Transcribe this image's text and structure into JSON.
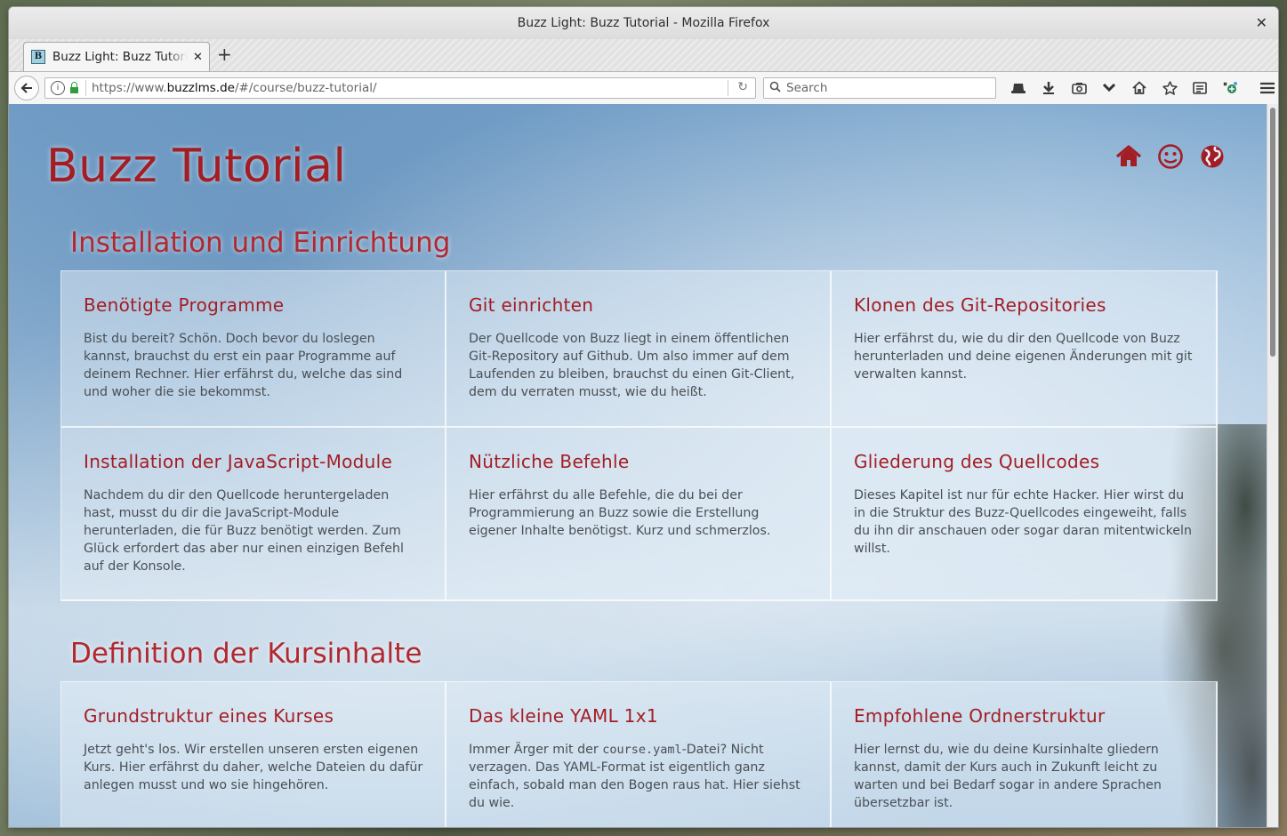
{
  "window": {
    "title": "Buzz Light: Buzz Tutorial - Mozilla Firefox"
  },
  "tab": {
    "favicon_letter": "B",
    "title": "Buzz Light: Buzz Tutorial"
  },
  "nav": {
    "url_prefix": "https://www.",
    "url_domain": "buzzlms.de",
    "url_path": "/#/course/buzz-tutorial/",
    "search_placeholder": "Search"
  },
  "toolbar_icons": [
    "hat-icon",
    "download-icon",
    "screenshot-icon",
    "pocket-icon",
    "home-icon",
    "bookmark-star-icon",
    "reader-icon",
    "extension-icon",
    "menu-icon"
  ],
  "page": {
    "title": "Buzz Tutorial",
    "header_icons": [
      "home-icon",
      "smiley-icon",
      "globe-icon"
    ],
    "accent_color": "#a31d24"
  },
  "sections": [
    {
      "title": "Installation und Einrichtung",
      "cards": [
        {
          "title": "Benötigte Programme",
          "text": "Bist du bereit? Schön. Doch bevor du loslegen kannst, brauchst du erst ein paar Programme auf deinem Rechner. Hier erfährst du, welche das sind und woher die sie bekommst."
        },
        {
          "title": "Git einrichten",
          "text": "Der Quellcode von Buzz liegt in einem öffentlichen Git-Repository auf Github. Um also immer auf dem Laufenden zu bleiben, brauchst du einen Git-Client, dem du verraten musst, wie du heißt."
        },
        {
          "title": "Klonen des Git-Repositories",
          "text": "Hier erfährst du, wie du dir den Quellcode von Buzz herunterladen und deine eigenen Änderungen mit git verwalten kannst."
        },
        {
          "title": "Installation der JavaScript-Module",
          "text": "Nachdem du dir den Quellcode heruntergeladen hast, musst du dir die JavaScript-Module herunterladen, die für Buzz benötigt werden. Zum Glück erfordert das aber nur einen einzigen Befehl auf der Konsole."
        },
        {
          "title": "Nützliche Befehle",
          "text": "Hier erfährst du alle Befehle, die du bei der Programmierung an Buzz sowie die Erstellung eigener Inhalte benötigst. Kurz und schmerzlos."
        },
        {
          "title": "Gliederung des Quellcodes",
          "text": "Dieses Kapitel ist nur für echte Hacker. Hier wirst du in die Struktur des Buzz-Quellcodes eingeweiht, falls du ihn dir anschauen oder sogar daran mitentwickeln willst."
        }
      ]
    },
    {
      "title": "Definition der Kursinhalte",
      "cards": [
        {
          "title": "Grundstruktur eines Kurses",
          "text": "Jetzt geht's los. Wir erstellen unseren ersten eigenen Kurs. Hier erfährst du daher, welche Dateien du dafür anlegen musst und wo sie hingehören."
        },
        {
          "title": "Das kleine YAML 1x1",
          "text_before": "Immer Ärger mit der ",
          "code": "course.yaml",
          "text_after": "-Datei? Nicht verzagen. Das YAML-Format ist eigentlich ganz einfach, sobald man den Bogen raus hat. Hier siehst du wie."
        },
        {
          "title": "Empfohlene Ordnerstruktur",
          "text": "Hier lernst du, wie du deine Kursinhalte gliedern kannst, damit der Kurs auch in Zukunft leicht zu warten und bei Bedarf sogar in andere Sprachen übersetzbar ist."
        }
      ]
    }
  ]
}
